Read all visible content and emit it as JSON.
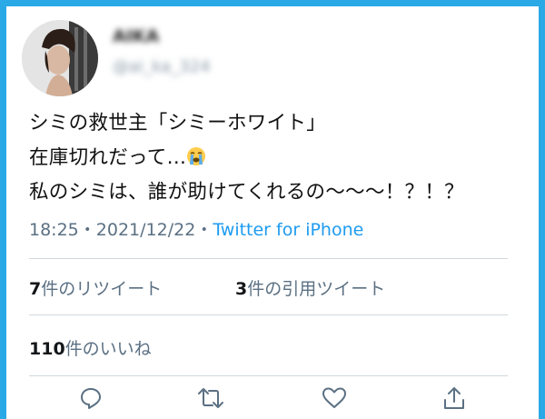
{
  "user": {
    "display_name": "AIKA",
    "handle": "@ai_ka_324"
  },
  "tweet": {
    "lines": [
      "シミの救世主「シミーホワイト」",
      "在庫切れだって…",
      "私のシミは、誰が助けてくれるの〜〜〜！？！？"
    ],
    "emoji": "loudly-crying-face"
  },
  "meta": {
    "time": "18:25",
    "dot1": "・",
    "date": "2021/12/22",
    "dot2": "・",
    "via": "Twitter for iPhone"
  },
  "stats": {
    "retweets_count": "7",
    "retweets_label": "件のリツイート",
    "quotes_count": "3",
    "quotes_label": "件の引用ツイート",
    "likes_count": "110",
    "likes_label": "件のいいね"
  },
  "actions": {
    "icons": [
      "reply-icon",
      "retweet-icon",
      "like-icon",
      "share-icon"
    ]
  },
  "colors": {
    "frame": "#29a9e6",
    "link": "#1d9bf0",
    "secondary_text": "#5b7083",
    "divider": "#cfd9de"
  }
}
